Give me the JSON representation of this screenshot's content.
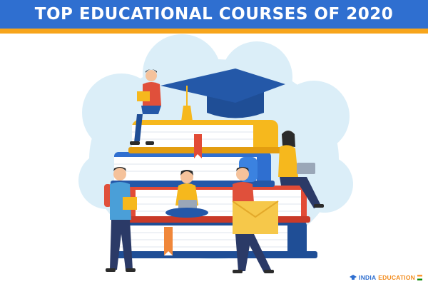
{
  "banner": {
    "title": "TOP EDUCATIONAL COURSES OF 2020",
    "primary_color": "#2f6fd0",
    "accent_color": "#f7a51c"
  },
  "illustration": {
    "cloud_color": "#dbeef8",
    "book_colors": [
      "#f6b81d",
      "#f4a61a",
      "#2f6fd0",
      "#1f4e96",
      "#e24b36",
      "#f0873a"
    ],
    "cap_color": "#1f4e96",
    "icons": [
      "graduation-cap-icon",
      "bookmark-icon",
      "laptop-icon",
      "book-icon"
    ]
  },
  "brand": {
    "part1": "INDIA",
    "part2": "EDUCATION",
    "icon": "cap-logo-icon"
  }
}
